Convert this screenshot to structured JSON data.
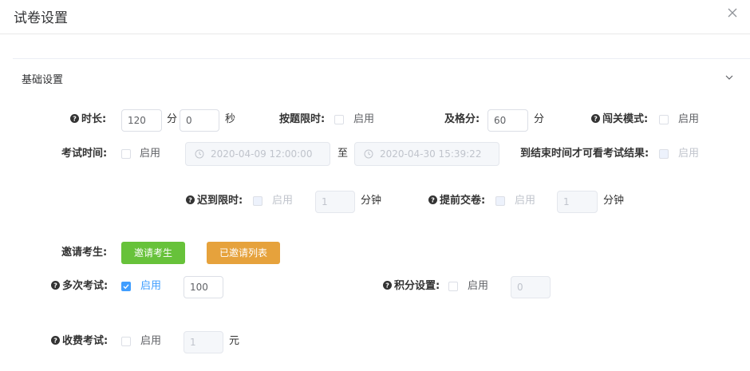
{
  "dialog": {
    "title": "试卷设置"
  },
  "section": {
    "title": "基础设置"
  },
  "duration": {
    "label": "时长:",
    "hours": "120",
    "hours_unit": "分",
    "minutes": "0",
    "minutes_unit": "秒"
  },
  "question_limit": {
    "label": "按题限时:",
    "option": "启用"
  },
  "pass_score": {
    "label": "及格分:",
    "value": "60",
    "unit": "分"
  },
  "level_mode": {
    "label": "闯关模式:",
    "option": "启用"
  },
  "exam_time": {
    "label": "考试时间:",
    "option": "启用",
    "start": "2020-04-09 12:00:00",
    "separator": "至",
    "end": "2020-04-30 15:39:22"
  },
  "view_result": {
    "label": "到结束时间才可看考试结果:",
    "option": "启用"
  },
  "late_limit": {
    "label": "迟到限时:",
    "option": "启用",
    "value": "1",
    "unit": "分钟"
  },
  "early_submit": {
    "label": "提前交卷:",
    "option": "启用",
    "value": "1",
    "unit": "分钟"
  },
  "invite": {
    "label": "邀请考生:",
    "invite_button": "邀请考生",
    "list_button": "已邀请列表"
  },
  "multi_exam": {
    "label": "多次考试:",
    "option": "启用",
    "value": "100"
  },
  "points": {
    "label": "积分设置:",
    "option": "启用",
    "value": "0"
  },
  "paid_exam": {
    "label": "收费考试:",
    "option": "启用",
    "value": "1",
    "unit": "元"
  },
  "colors": {
    "primary": "#409eff",
    "success": "#67c23a",
    "warning": "#e6a23c",
    "border": "#dcdfe6"
  },
  "icons": {
    "help": "question-circle-icon",
    "close": "close-icon",
    "collapse": "chevron-down-icon",
    "time": "clock-icon",
    "checked": "checkmark-icon"
  }
}
